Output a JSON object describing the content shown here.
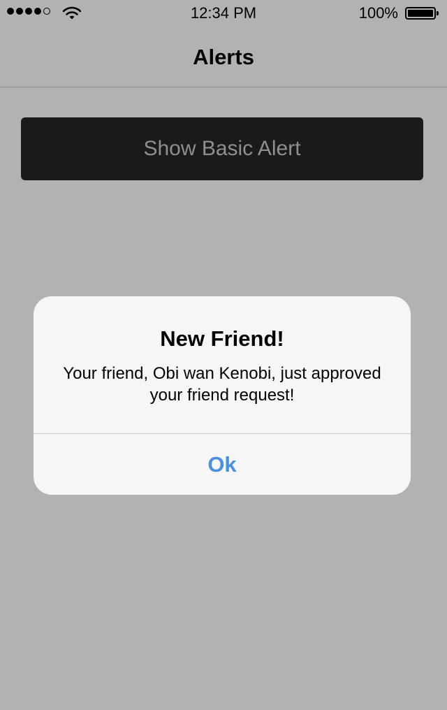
{
  "status_bar": {
    "signal_bars_filled": 4,
    "signal_bars_total": 5,
    "time": "12:34 PM",
    "battery_percent_label": "100%",
    "battery_level": 1.0
  },
  "nav": {
    "title": "Alerts"
  },
  "main": {
    "show_alert_label": "Show Basic Alert"
  },
  "alert": {
    "title": "New Friend!",
    "message": "Your friend, Obi wan Kenobi, just approved your friend request!",
    "ok_label": "Ok"
  },
  "colors": {
    "overlay_background": "#b2b2b2",
    "button_background": "#1a1a1a",
    "button_text": "#8f8f8f",
    "alert_background": "#f6f6f6",
    "accent": "#4a90e2"
  }
}
